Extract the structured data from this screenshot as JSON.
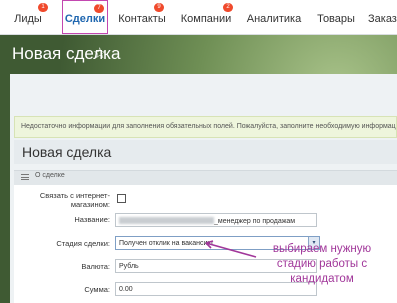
{
  "nav": {
    "tabs": [
      {
        "label": "Лиды",
        "badge": "1"
      },
      {
        "label": "Сделки",
        "badge": "7",
        "active": true
      },
      {
        "label": "Контакты",
        "badge": "9"
      },
      {
        "label": "Компании",
        "badge": "2"
      },
      {
        "label": "Аналитика",
        "badge": ""
      },
      {
        "label": "Товары",
        "badge": ""
      },
      {
        "label": "Заказ",
        "badge": ""
      }
    ]
  },
  "page": {
    "title": "Новая сделка",
    "star": "☆"
  },
  "alert": "Недостаточно информации для заполнения обязательных полей. Пожалуйста, заполните необходимую информацию",
  "form": {
    "title": "Новая сделка",
    "section": "О сделке",
    "fields": {
      "link_label": "Связать с интернет-магазином:",
      "name_label": "Название:",
      "name_value": "_менеджер по продажам",
      "stage_label": "Стадия сделки:",
      "stage_value": "Получен отклик на вакансию",
      "currency_label": "Валюта:",
      "currency_value": "Рубль",
      "amount_label": "Сумма:",
      "amount_value": "0.00"
    }
  },
  "annotation": "выбираем нужную стадию работы с кандидатом",
  "colors": {
    "annotation": "#a1379a",
    "active_tab_border": "#c347b0",
    "badge": "#f04a2c"
  }
}
